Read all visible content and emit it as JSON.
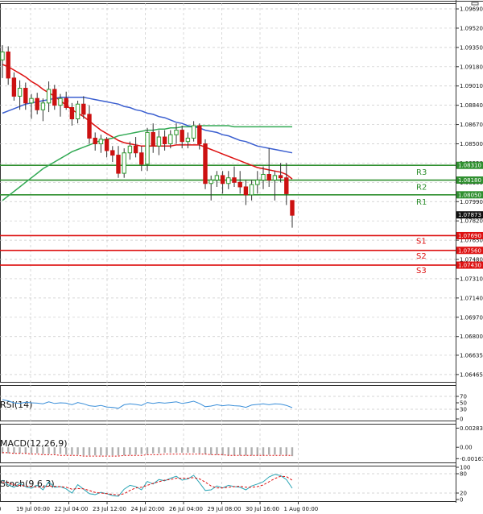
{
  "chart_data": {
    "type": "candlestick",
    "grid": true,
    "price_axis": {
      "ylim": [
        1.064,
        1.0974
      ],
      "ticks": [
        "1.09690",
        "1.09520",
        "1.09350",
        "1.09180",
        "1.09010",
        "1.08840",
        "1.08670",
        "1.08500",
        "1.08330",
        "1.08160",
        "1.07990",
        "1.07820",
        "1.07650",
        "1.07480",
        "1.07310",
        "1.07140",
        "1.06970",
        "1.06800",
        "1.06635",
        "1.06465"
      ],
      "current_price": "1.07873"
    },
    "x_axis": {
      "tick_labels": [
        "19 Jul 00:00",
        "22 Jul 04:00",
        "23 Jul 12:00",
        "24 Jul 20:00",
        "26 Jul 04:00",
        "29 Jul 08:00",
        "30 Jul 16:00",
        "1 Aug 00:00"
      ]
    },
    "candles": [
      {
        "o": 1.0924,
        "h": 1.0937,
        "l": 1.0908,
        "c": 1.0931
      },
      {
        "o": 1.0931,
        "h": 1.0936,
        "l": 1.0902,
        "c": 1.0908
      },
      {
        "o": 1.0908,
        "h": 1.0913,
        "l": 1.0888,
        "c": 1.0892
      },
      {
        "o": 1.0892,
        "h": 1.0906,
        "l": 1.088,
        "c": 1.0899
      },
      {
        "o": 1.0899,
        "h": 1.0904,
        "l": 1.088,
        "c": 1.0886
      },
      {
        "o": 1.0886,
        "h": 1.0894,
        "l": 1.0872,
        "c": 1.089
      },
      {
        "o": 1.089,
        "h": 1.0895,
        "l": 1.0876,
        "c": 1.088
      },
      {
        "o": 1.088,
        "h": 1.089,
        "l": 1.087,
        "c": 1.0886
      },
      {
        "o": 1.0886,
        "h": 1.0905,
        "l": 1.0878,
        "c": 1.0898
      },
      {
        "o": 1.0898,
        "h": 1.0902,
        "l": 1.088,
        "c": 1.0884
      },
      {
        "o": 1.0884,
        "h": 1.0894,
        "l": 1.0874,
        "c": 1.089
      },
      {
        "o": 1.089,
        "h": 1.0896,
        "l": 1.088,
        "c": 1.0882
      },
      {
        "o": 1.0882,
        "h": 1.0886,
        "l": 1.0866,
        "c": 1.0872
      },
      {
        "o": 1.0872,
        "h": 1.0888,
        "l": 1.0868,
        "c": 1.0885
      },
      {
        "o": 1.0885,
        "h": 1.0892,
        "l": 1.0872,
        "c": 1.0876
      },
      {
        "o": 1.0876,
        "h": 1.0884,
        "l": 1.085,
        "c": 1.0855
      },
      {
        "o": 1.0855,
        "h": 1.086,
        "l": 1.0844,
        "c": 1.085
      },
      {
        "o": 1.085,
        "h": 1.0858,
        "l": 1.0842,
        "c": 1.0854
      },
      {
        "o": 1.0854,
        "h": 1.0856,
        "l": 1.0838,
        "c": 1.0844
      },
      {
        "o": 1.0844,
        "h": 1.0848,
        "l": 1.0834,
        "c": 1.084
      },
      {
        "o": 1.084,
        "h": 1.0848,
        "l": 1.082,
        "c": 1.0824
      },
      {
        "o": 1.0824,
        "h": 1.0846,
        "l": 1.082,
        "c": 1.0842
      },
      {
        "o": 1.0842,
        "h": 1.0852,
        "l": 1.0836,
        "c": 1.0848
      },
      {
        "o": 1.0848,
        "h": 1.0856,
        "l": 1.0838,
        "c": 1.0842
      },
      {
        "o": 1.0842,
        "h": 1.0848,
        "l": 1.0826,
        "c": 1.0832
      },
      {
        "o": 1.0832,
        "h": 1.0864,
        "l": 1.0826,
        "c": 1.086
      },
      {
        "o": 1.086,
        "h": 1.0868,
        "l": 1.0842,
        "c": 1.0848
      },
      {
        "o": 1.0848,
        "h": 1.0862,
        "l": 1.084,
        "c": 1.0856
      },
      {
        "o": 1.0856,
        "h": 1.0862,
        "l": 1.0844,
        "c": 1.085
      },
      {
        "o": 1.085,
        "h": 1.0862,
        "l": 1.0846,
        "c": 1.0858
      },
      {
        "o": 1.0858,
        "h": 1.0868,
        "l": 1.085,
        "c": 1.0862
      },
      {
        "o": 1.0862,
        "h": 1.0866,
        "l": 1.0846,
        "c": 1.0852
      },
      {
        "o": 1.0852,
        "h": 1.086,
        "l": 1.0846,
        "c": 1.0855
      },
      {
        "o": 1.0855,
        "h": 1.087,
        "l": 1.0852,
        "c": 1.0866
      },
      {
        "o": 1.0866,
        "h": 1.0868,
        "l": 1.0845,
        "c": 1.085
      },
      {
        "o": 1.085,
        "h": 1.0854,
        "l": 1.081,
        "c": 1.0815
      },
      {
        "o": 1.0815,
        "h": 1.0822,
        "l": 1.08,
        "c": 1.0818
      },
      {
        "o": 1.0818,
        "h": 1.0826,
        "l": 1.0812,
        "c": 1.0822
      },
      {
        "o": 1.0822,
        "h": 1.0826,
        "l": 1.0806,
        "c": 1.0815
      },
      {
        "o": 1.0815,
        "h": 1.0826,
        "l": 1.081,
        "c": 1.082
      },
      {
        "o": 1.082,
        "h": 1.083,
        "l": 1.0812,
        "c": 1.0816
      },
      {
        "o": 1.0816,
        "h": 1.0826,
        "l": 1.0806,
        "c": 1.0812
      },
      {
        "o": 1.0812,
        "h": 1.0818,
        "l": 1.0796,
        "c": 1.0805
      },
      {
        "o": 1.0805,
        "h": 1.0818,
        "l": 1.08,
        "c": 1.0814
      },
      {
        "o": 1.0814,
        "h": 1.0826,
        "l": 1.0806,
        "c": 1.0818
      },
      {
        "o": 1.0818,
        "h": 1.083,
        "l": 1.081,
        "c": 1.0823
      },
      {
        "o": 1.0823,
        "h": 1.0846,
        "l": 1.0812,
        "c": 1.0818
      },
      {
        "o": 1.0818,
        "h": 1.0826,
        "l": 1.08,
        "c": 1.0822
      },
      {
        "o": 1.0822,
        "h": 1.0833,
        "l": 1.0816,
        "c": 1.082
      },
      {
        "o": 1.082,
        "h": 1.0833,
        "l": 1.0796,
        "c": 1.0806
      },
      {
        "o": 1.08,
        "h": 1.08,
        "l": 1.0776,
        "c": 1.0787
      }
    ],
    "moving_averages": [
      {
        "color": "#dd1111",
        "values": [
          1.092,
          1.0918,
          1.0915,
          1.0912,
          1.0909,
          1.0905,
          1.0902,
          1.0898,
          1.0895,
          1.0892,
          1.0888,
          1.0884,
          1.088,
          1.0877,
          1.0874,
          1.087,
          1.0866,
          1.0862,
          1.0859,
          1.0856,
          1.0853,
          1.0851,
          1.085,
          1.0849,
          1.0848,
          1.0848,
          1.0848,
          1.0848,
          1.0848,
          1.0848,
          1.0849,
          1.0849,
          1.0849,
          1.0849,
          1.0849,
          1.0847,
          1.0845,
          1.0843,
          1.0841,
          1.0839,
          1.0837,
          1.0835,
          1.0833,
          1.0831,
          1.0829,
          1.0828,
          1.0827,
          1.0826,
          1.0825,
          1.0823,
          1.0819
        ]
      },
      {
        "color": "#3b5fd0",
        "values": [
          1.0877,
          1.0879,
          1.0881,
          1.0883,
          1.0885,
          1.0886,
          1.0887,
          1.0888,
          1.0889,
          1.089,
          1.0891,
          1.0891,
          1.0891,
          1.0891,
          1.0891,
          1.089,
          1.0889,
          1.0888,
          1.0887,
          1.0886,
          1.0885,
          1.0883,
          1.0882,
          1.088,
          1.0879,
          1.0877,
          1.0876,
          1.0874,
          1.0873,
          1.0871,
          1.0869,
          1.0868,
          1.0866,
          1.0865,
          1.0864,
          1.0862,
          1.0861,
          1.086,
          1.0858,
          1.0857,
          1.0855,
          1.0853,
          1.0852,
          1.085,
          1.0848,
          1.0847,
          1.0846,
          1.0845,
          1.0844,
          1.0843,
          1.0842
        ]
      },
      {
        "color": "#33aa55",
        "values": [
          1.08,
          1.0804,
          1.0808,
          1.0812,
          1.0816,
          1.082,
          1.0824,
          1.0828,
          1.0831,
          1.0834,
          1.0837,
          1.084,
          1.0843,
          1.0845,
          1.0847,
          1.0849,
          1.0851,
          1.0853,
          1.0854,
          1.0855,
          1.0857,
          1.0858,
          1.0859,
          1.086,
          1.0861,
          1.0862,
          1.0862,
          1.0863,
          1.0863,
          1.0864,
          1.0864,
          1.0865,
          1.0865,
          1.0865,
          1.0866,
          1.0866,
          1.0866,
          1.0866,
          1.0866,
          1.0866,
          1.0865,
          1.0865,
          1.0865,
          1.0865,
          1.0865,
          1.0865,
          1.0865,
          1.0865,
          1.0865,
          1.0865,
          1.0865
        ]
      }
    ],
    "levels": [
      {
        "name": "R3",
        "value": 1.0831,
        "label": "1.08310",
        "color": "#2f8f2f"
      },
      {
        "name": "R2",
        "value": 1.0818,
        "label": "1.08180",
        "color": "#2f8f2f"
      },
      {
        "name": "R1",
        "value": 1.0805,
        "label": "1.08050",
        "color": "#2f8f2f"
      },
      {
        "name": "S1",
        "value": 1.0769,
        "label": "1.07690",
        "color": "#dd1111"
      },
      {
        "name": "S2",
        "value": 1.0756,
        "label": "1.07560",
        "color": "#dd1111"
      },
      {
        "name": "S3",
        "value": 1.0743,
        "label": "1.07430",
        "color": "#dd1111"
      }
    ],
    "indicators": [
      {
        "title": "RSI(14)",
        "ticks": [
          "70",
          "50",
          "30",
          "0"
        ],
        "ylim": [
          0,
          100
        ],
        "tick_values": [
          70,
          50,
          30,
          0
        ],
        "values": [
          60,
          56,
          50,
          48,
          52,
          50,
          49,
          47,
          53,
          48,
          50,
          49,
          44,
          51,
          47,
          41,
          39,
          42,
          37,
          36,
          33,
          44,
          47,
          45,
          42,
          51,
          48,
          51,
          49,
          51,
          53,
          48,
          51,
          55,
          48,
          38,
          40,
          44,
          41,
          43,
          41,
          40,
          36,
          43,
          45,
          47,
          44,
          47,
          46,
          42,
          35
        ],
        "color": "#3b8fd9"
      },
      {
        "title": "MACD(12,26,9)",
        "ticks": [
          "0.00283",
          "0.00",
          "-0.001679"
        ],
        "ylim": [
          -0.002,
          0.003
        ],
        "tick_values": [
          0.00283,
          0.0,
          -0.001679
        ],
        "histogram": [
          -0.0009,
          -0.0009,
          -0.0009,
          -0.0009,
          -0.0009,
          -0.0009,
          -0.0009,
          -0.001,
          -0.001,
          -0.001,
          -0.001,
          -0.0011,
          -0.0011,
          -0.0011,
          -0.0012,
          -0.0012,
          -0.0012,
          -0.0012,
          -0.0012,
          -0.0012,
          -0.0012,
          -0.0012,
          -0.0011,
          -0.0011,
          -0.001,
          -0.001,
          -0.0009,
          -0.0009,
          -0.0008,
          -0.0008,
          -0.0008,
          -0.0008,
          -0.0008,
          -0.0008,
          -0.0009,
          -0.001,
          -0.0011,
          -0.0011,
          -0.0012,
          -0.0012,
          -0.0012,
          -0.0012,
          -0.0012,
          -0.0012,
          -0.0012,
          -0.0012,
          -0.0011,
          -0.0011,
          -0.0011,
          -0.0012,
          -0.0013
        ],
        "signal": [
          -0.0008,
          -0.0008,
          -0.0009,
          -0.0009,
          -0.0009,
          -0.001,
          -0.001,
          -0.0011,
          -0.0011,
          -0.0011,
          -0.0012,
          -0.0012,
          -0.0012,
          -0.0012,
          -0.0013,
          -0.0013,
          -0.0013,
          -0.0013,
          -0.0013,
          -0.0013,
          -0.0013,
          -0.0012,
          -0.0012,
          -0.0012,
          -0.0012,
          -0.0011,
          -0.0011,
          -0.0011,
          -0.001,
          -0.001,
          -0.001,
          -0.001,
          -0.001,
          -0.001,
          -0.001,
          -0.001,
          -0.0011,
          -0.0011,
          -0.0011,
          -0.0012,
          -0.0012,
          -0.0012,
          -0.0012,
          -0.0012,
          -0.0012,
          -0.0012,
          -0.0012,
          -0.0012,
          -0.0012,
          -0.0012,
          -0.0012
        ],
        "color": "#dd1111"
      },
      {
        "title": "Stoch(9,6,3)",
        "ticks": [
          "100",
          "80",
          "20",
          "0"
        ],
        "ylim": [
          0,
          100
        ],
        "tick_values": [
          100,
          80,
          20,
          0
        ],
        "main": [
          60,
          45,
          38,
          50,
          40,
          35,
          44,
          30,
          55,
          38,
          40,
          33,
          20,
          46,
          32,
          18,
          15,
          22,
          18,
          12,
          10,
          32,
          44,
          40,
          30,
          56,
          48,
          62,
          58,
          66,
          72,
          60,
          64,
          75,
          52,
          28,
          30,
          42,
          36,
          44,
          40,
          38,
          30,
          42,
          48,
          55,
          70,
          78,
          74,
          62,
          35
        ],
        "signal": [
          55,
          52,
          45,
          44,
          42,
          40,
          39,
          38,
          42,
          41,
          40,
          38,
          32,
          34,
          33,
          28,
          22,
          20,
          18,
          16,
          14,
          18,
          28,
          36,
          38,
          44,
          50,
          55,
          60,
          62,
          66,
          66,
          66,
          68,
          64,
          54,
          42,
          36,
          36,
          38,
          40,
          41,
          38,
          38,
          40,
          45,
          55,
          65,
          72,
          71,
          60
        ],
        "main_color": "#2aa5b5",
        "signal_color": "#dd1111"
      }
    ]
  }
}
